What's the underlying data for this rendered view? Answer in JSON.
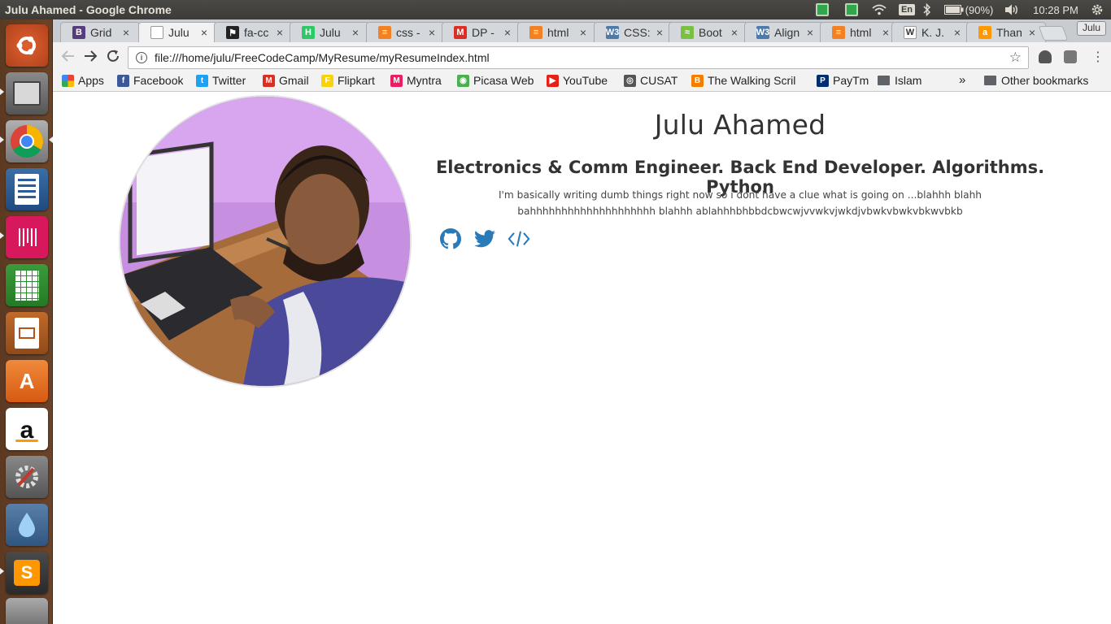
{
  "system": {
    "window_title": "Julu Ahamed - Google Chrome",
    "battery": "(90%)",
    "clock": "10:28 PM",
    "keyboard_layout": "En"
  },
  "tabs": [
    {
      "label": "Grid",
      "favicon": "bootstrap-icon",
      "color": "#563d7c",
      "glyph": "B"
    },
    {
      "label": "Julu",
      "favicon": "page-icon",
      "color": "#ffffff",
      "glyph": "",
      "active": true
    },
    {
      "label": "fa-cc",
      "favicon": "flag-icon",
      "color": "#222222",
      "glyph": "⚑"
    },
    {
      "label": "Julu",
      "favicon": "hackerrank-icon",
      "color": "#2ec866",
      "glyph": "H"
    },
    {
      "label": "css -",
      "favicon": "stackoverflow-icon",
      "color": "#f48024",
      "glyph": "≡"
    },
    {
      "label": "DP -",
      "favicon": "gmail-icon",
      "color": "#d93025",
      "glyph": "M"
    },
    {
      "label": "html",
      "favicon": "stackoverflow-icon",
      "color": "#f48024",
      "glyph": "≡"
    },
    {
      "label": "CSS:",
      "favicon": "w3schools-icon",
      "color": "#4d7aa8",
      "glyph": "W3"
    },
    {
      "label": "Boot",
      "favicon": "codeply-icon",
      "color": "#7ac143",
      "glyph": "≈"
    },
    {
      "label": "Align",
      "favicon": "w3schools-icon",
      "color": "#4d7aa8",
      "glyph": "W3"
    },
    {
      "label": "html",
      "favicon": "stackoverflow-icon",
      "color": "#f48024",
      "glyph": "≡"
    },
    {
      "label": "K. J.",
      "favicon": "wikipedia-icon",
      "color": "#ffffff",
      "glyph": "W"
    },
    {
      "label": "Than",
      "favicon": "amazon-icon",
      "color": "#ff9900",
      "glyph": "a"
    }
  ],
  "profile_label": "Julu",
  "omnibox": {
    "url": "file:///home/julu/FreeCodeCamp/MyResume/myResumeIndex.html"
  },
  "bookmarks": [
    {
      "label": "Apps",
      "icon": "apps-grid-icon"
    },
    {
      "label": "Facebook",
      "icon": "facebook-icon",
      "color": "#3b5998",
      "glyph": "f"
    },
    {
      "label": "Twitter",
      "icon": "twitter-icon",
      "color": "#1da1f2",
      "glyph": "t"
    },
    {
      "label": "Gmail",
      "icon": "gmail-icon",
      "color": "#d93025",
      "glyph": "M"
    },
    {
      "label": "Flipkart",
      "icon": "flipkart-icon",
      "color": "#f8d30b",
      "glyph": "F"
    },
    {
      "label": "Myntra",
      "icon": "myntra-icon",
      "color": "#e91e63",
      "glyph": "M"
    },
    {
      "label": "Picasa Web",
      "icon": "picasa-icon",
      "color": "#4caf50",
      "glyph": "◉"
    },
    {
      "label": "YouTube",
      "icon": "youtube-icon",
      "color": "#e62117",
      "glyph": "▶"
    },
    {
      "label": "CUSAT",
      "icon": "cusat-icon",
      "color": "#555555",
      "glyph": "◎"
    },
    {
      "label": "The Walking Scril",
      "icon": "blogger-icon",
      "color": "#f57d00",
      "glyph": "B"
    },
    {
      "label": "PayTm",
      "icon": "paytm-icon",
      "color": "#002e6e",
      "glyph": "P"
    },
    {
      "label": "Islam",
      "icon": "folder-icon"
    }
  ],
  "bookmarks_overflow": "»",
  "other_bookmarks": "Other bookmarks",
  "page": {
    "name": "Julu Ahamed",
    "headline": "Electronics & Comm Engineer. Back End Developer. Algorithms. Python",
    "bio": "I'm basically writing dumb things right now so i dont have a clue what is going on ...blahhh blahh bahhhhhhhhhhhhhhhhhhhh blahhh ablahhhbhbbdcbwcwjvvwkvjwkdjvbwkvbwkvbkwvbkb",
    "social": [
      {
        "name": "github-icon",
        "color": "#2a7ab8"
      },
      {
        "name": "twitter-icon",
        "color": "#2a7ab8"
      },
      {
        "name": "code-icon",
        "color": "#2a7ab8"
      }
    ]
  },
  "launcher": [
    {
      "name": "ubuntu-dash-icon"
    },
    {
      "name": "files-icon"
    },
    {
      "name": "chrome-icon"
    },
    {
      "name": "writer-icon"
    },
    {
      "name": "gitkraken-icon"
    },
    {
      "name": "calc-icon"
    },
    {
      "name": "impress-icon"
    },
    {
      "name": "software-center-icon"
    },
    {
      "name": "amazon-icon"
    },
    {
      "name": "system-settings-icon"
    },
    {
      "name": "drop-icon"
    },
    {
      "name": "sublime-text-icon"
    },
    {
      "name": "trash-icon"
    }
  ]
}
